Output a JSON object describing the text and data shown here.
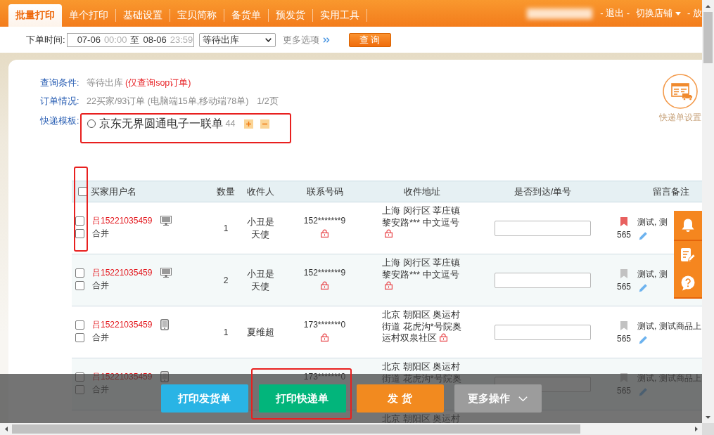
{
  "nav": {
    "tabs": [
      {
        "label": "批量打印",
        "selected": true
      },
      {
        "label": "单个打印",
        "selected": false
      },
      {
        "label": "基础设置",
        "selected": false
      },
      {
        "label": "宝贝简称",
        "selected": false
      },
      {
        "label": "备货单",
        "selected": false
      },
      {
        "label": "预发货",
        "selected": false
      },
      {
        "label": "实用工具",
        "selected": false
      }
    ],
    "links": [
      {
        "label": "- 退出 -",
        "dropdown": false
      },
      {
        "label": "切换店铺",
        "dropdown": true
      },
      {
        "label": "- 放",
        "dropdown": false
      }
    ]
  },
  "filters": {
    "order_time": {
      "label": "下单时间:",
      "start_date": "07-06",
      "start_time": "00:00",
      "separator": "至",
      "end_date": "08-06",
      "end_time": "23:59"
    },
    "status": "等待出库",
    "more_options": "更多选项",
    "query_button": "查 询"
  },
  "summary": {
    "query_condition": {
      "label": "查询条件:",
      "value": "等待出库",
      "note": "(仅查询sop订单)"
    },
    "order_status": {
      "label": "订单情况:",
      "value": "22买家/93订单 (电脑端15单,移动端78单)",
      "page": "1/2页"
    },
    "express_template": {
      "label": "快递模板:",
      "options": [
        {
          "name": "京东无界圆通电子一联单",
          "count": "44",
          "selected": false
        }
      ]
    }
  },
  "express_settings": {
    "label": "快递单设置"
  },
  "table": {
    "select_all_checked": false,
    "columns": [
      "买家用户名",
      "数量",
      "收件人",
      "联系号码",
      "收件地址",
      "是否到达/单号",
      "留言备注"
    ],
    "rows": [
      {
        "kind": "order",
        "selected": false,
        "buyer": "吕15221035459",
        "merge": {
          "label": "合并",
          "checked": false
        },
        "device": {
          "kind": "desktop"
        },
        "quantity": "1",
        "recipient": "小丑是天使",
        "phone": "152*******9",
        "address": "上海 闵行区 莘庄镇黎安路*** 中文逗号",
        "encrypted": true,
        "flagged": true,
        "remark_count": "565",
        "remark": "测试, 测"
      },
      {
        "kind": "order",
        "selected": false,
        "buyer": "吕15221035459",
        "merge": {
          "label": "合并",
          "checked": false
        },
        "device": {
          "kind": "desktop"
        },
        "quantity": "2",
        "recipient": "小丑是天使",
        "phone": "152*******9",
        "address": "上海 闵行区 莘庄镇黎安路*** 中文逗号",
        "encrypted": true,
        "flagged": false,
        "remark_count": "565",
        "remark": "测试, 测"
      },
      {
        "kind": "order",
        "selected": false,
        "buyer": "吕15221035459",
        "merge": {
          "label": "合并",
          "checked": false
        },
        "device": {
          "kind": "mobile"
        },
        "quantity": "1",
        "recipient": "夏维超",
        "phone": "173*******0",
        "address": "北京 朝阳区 奥运村街道 花虎沟*号院奥运村双泉社区",
        "encrypted": true,
        "flagged": false,
        "remark_count": "565",
        "remark": "测试, 测试商品上"
      },
      {
        "kind": "order",
        "selected": false,
        "buyer": "吕15221035459",
        "merge": {
          "label": "合并",
          "checked": false
        },
        "device": {
          "kind": "mobile"
        },
        "phone": "173*******0",
        "address": "北京 朝阳区 奥运村街道 花虎沟*号院奥",
        "flagged": false,
        "remark_count": "565",
        "remark": "测试, 测试商品上"
      },
      {
        "kind": "partial",
        "address": "北京 朝阳区 奥运村"
      }
    ]
  },
  "action_bar": {
    "buttons": [
      {
        "label": "打印发货单",
        "kind": "info"
      },
      {
        "label": "打印快递单",
        "kind": "success"
      },
      {
        "label": "发 货",
        "kind": "warning"
      },
      {
        "label": "更多操作",
        "kind": "menu"
      }
    ]
  }
}
